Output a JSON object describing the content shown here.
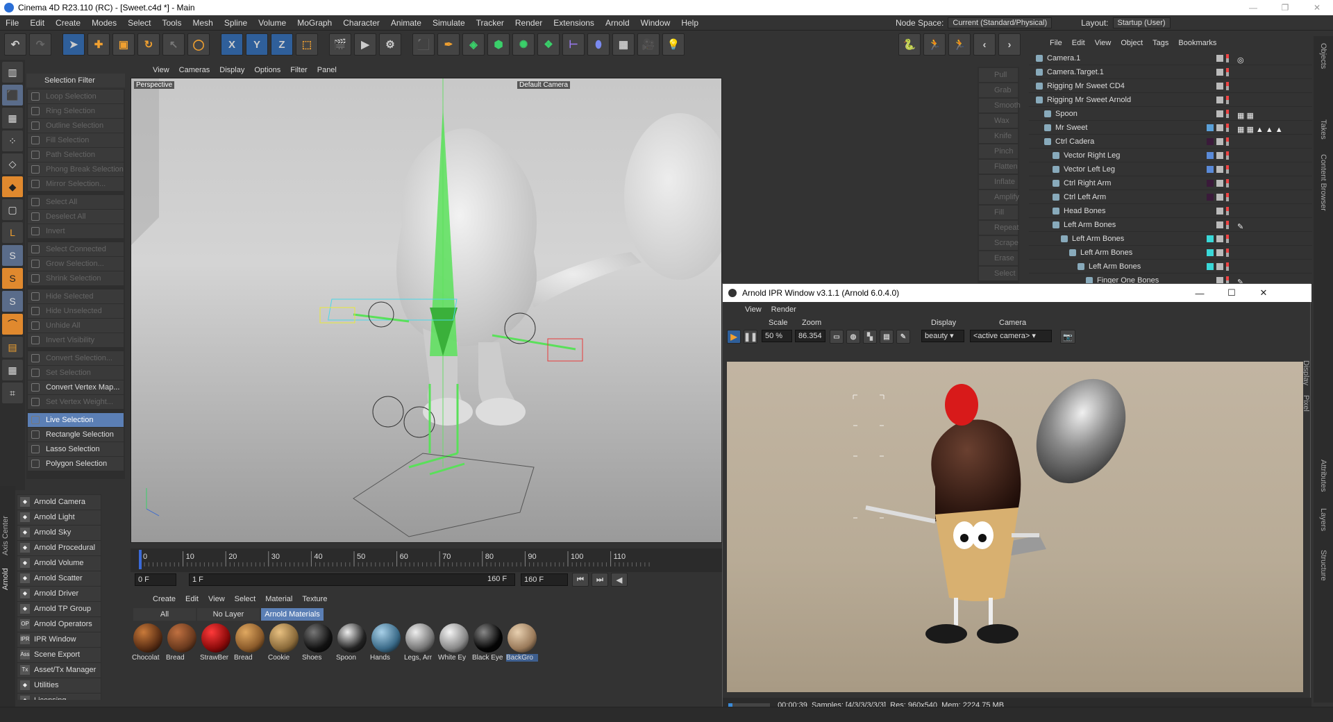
{
  "window": {
    "title": "Cinema 4D R23.110 (RC) - [Sweet.c4d *] - Main",
    "controls": [
      "—",
      "❐",
      "✕"
    ]
  },
  "menubar": {
    "items": [
      "File",
      "Edit",
      "Create",
      "Modes",
      "Select",
      "Tools",
      "Mesh",
      "Spline",
      "Volume",
      "MoGraph",
      "Character",
      "Animate",
      "Simulate",
      "Tracker",
      "Render",
      "Extensions",
      "Arnold",
      "Window",
      "Help"
    ],
    "node_space_label": "Node Space:",
    "node_space_value": "Current (Standard/Physical)",
    "layout_label": "Layout:",
    "layout_value": "Startup (User)"
  },
  "toolbar": {
    "axis_x": "X",
    "axis_y": "Y",
    "axis_z": "Z"
  },
  "selection_menu": {
    "header": "Selection Filter",
    "items": [
      {
        "label": "Loop Selection",
        "enabled": false
      },
      {
        "label": "Ring Selection",
        "enabled": false
      },
      {
        "label": "Outline Selection",
        "enabled": false
      },
      {
        "label": "Fill Selection",
        "enabled": false
      },
      {
        "label": "Path Selection",
        "enabled": false
      },
      {
        "label": "Phong Break Selection",
        "enabled": false
      },
      {
        "label": "Mirror Selection...",
        "enabled": false
      },
      {
        "label": "Select All",
        "enabled": false,
        "gap": true
      },
      {
        "label": "Deselect All",
        "enabled": false
      },
      {
        "label": "Invert",
        "enabled": false
      },
      {
        "label": "Select Connected",
        "enabled": false,
        "gap": true
      },
      {
        "label": "Grow Selection...",
        "enabled": false
      },
      {
        "label": "Shrink Selection",
        "enabled": false
      },
      {
        "label": "Hide Selected",
        "enabled": false,
        "gap": true
      },
      {
        "label": "Hide Unselected",
        "enabled": false
      },
      {
        "label": "Unhide All",
        "enabled": false
      },
      {
        "label": "Invert Visibility",
        "enabled": false
      },
      {
        "label": "Convert Selection...",
        "enabled": false,
        "gap": true
      },
      {
        "label": "Set Selection",
        "enabled": false
      },
      {
        "label": "Convert Vertex Map...",
        "enabled": true
      },
      {
        "label": "Set Vertex Weight...",
        "enabled": false
      },
      {
        "label": "Live Selection",
        "enabled": true,
        "active": true,
        "gap": true
      },
      {
        "label": "Rectangle Selection",
        "enabled": true
      },
      {
        "label": "Lasso Selection",
        "enabled": true
      },
      {
        "label": "Polygon Selection",
        "enabled": true
      }
    ]
  },
  "arnold_panel": {
    "side_tabs": [
      "Axis Center",
      "Arnold"
    ],
    "items": [
      {
        "label": "Arnold Camera",
        "icon": "camera-icon"
      },
      {
        "label": "Arnold Light",
        "icon": "light-icon"
      },
      {
        "label": "Arnold Sky",
        "icon": "sky-icon"
      },
      {
        "label": "Arnold Procedural",
        "icon": "procedural-icon"
      },
      {
        "label": "Arnold Volume",
        "icon": "volume-icon"
      },
      {
        "label": "Arnold Scatter",
        "icon": "scatter-icon"
      },
      {
        "label": "Arnold Driver",
        "icon": "driver-icon"
      },
      {
        "label": "Arnold TP Group",
        "icon": "tp-group-icon"
      },
      {
        "label": "Arnold Operators",
        "icon": "operators-icon",
        "glyph": "OP"
      },
      {
        "label": "IPR Window",
        "icon": "ipr-icon",
        "glyph": "IPR"
      },
      {
        "label": "Scene Export",
        "icon": "export-icon",
        "glyph": "Ass"
      },
      {
        "label": "Asset/Tx Manager",
        "icon": "tx-icon",
        "glyph": "Tx"
      },
      {
        "label": "Utilities",
        "icon": "utilities-icon"
      },
      {
        "label": "Licensing",
        "icon": "licensing-icon"
      }
    ]
  },
  "viewport": {
    "menu": [
      "View",
      "Cameras",
      "Display",
      "Options",
      "Filter",
      "Panel"
    ],
    "label": "Perspective",
    "camera_label": "Default Camera"
  },
  "sculpt": {
    "items": [
      "Pull",
      "Grab",
      "Smooth",
      "Wax",
      "Knife",
      "Pinch",
      "Flatten",
      "Inflate",
      "Amplify",
      "Fill",
      "Repeat",
      "Scrape",
      "Erase",
      "Select"
    ]
  },
  "timeline": {
    "ticks": [
      "0",
      "10",
      "20",
      "30",
      "40",
      "50",
      "60",
      "70",
      "80",
      "90",
      "100",
      "110"
    ],
    "current_frame": "0 F",
    "start_frame": "1 F",
    "end_frame_a": "160 F",
    "end_frame_b": "160 F"
  },
  "material_manager": {
    "menu": [
      "Create",
      "Edit",
      "View",
      "Select",
      "Material",
      "Texture"
    ],
    "tabs": [
      {
        "label": "All",
        "active": false
      },
      {
        "label": "No Layer",
        "active": false
      },
      {
        "label": "Arnold Materials",
        "active": true
      }
    ],
    "materials": [
      {
        "name": "Chocolat",
        "color": "#5a2e14",
        "hi": "#c97a3a",
        "selected": false
      },
      {
        "name": "Bread",
        "color": "#6a3a1e",
        "hi": "#c07040",
        "selected": false
      },
      {
        "name": "StrawBer",
        "color": "#8a0a0a",
        "hi": "#ff3a3a",
        "selected": false
      },
      {
        "name": "Bread",
        "color": "#8a5a2a",
        "hi": "#e0a860",
        "selected": false
      },
      {
        "name": "Cookie",
        "color": "#8a6a3a",
        "hi": "#e8c080",
        "selected": false
      },
      {
        "name": "Shoes",
        "color": "#111111",
        "hi": "#777777",
        "selected": false
      },
      {
        "name": "Spoon",
        "color": "#222222",
        "hi": "#eeeeee",
        "selected": false
      },
      {
        "name": "Hands",
        "color": "#3a6a88",
        "hi": "#a8d0e8",
        "selected": false
      },
      {
        "name": "Legs, Arr",
        "color": "#777777",
        "hi": "#eeeeee",
        "selected": false
      },
      {
        "name": "White Ey",
        "color": "#888888",
        "hi": "#f4f4f4",
        "selected": false
      },
      {
        "name": "Black Eye",
        "color": "#050505",
        "hi": "#888888",
        "selected": false
      },
      {
        "name": "BackGro",
        "color": "#9a7a5a",
        "hi": "#e8d0b0",
        "selected": true
      }
    ]
  },
  "object_manager": {
    "menu": [
      "File",
      "Edit",
      "View",
      "Object",
      "Tags",
      "Bookmarks"
    ],
    "side_tabs": [
      "Objects",
      "Takes",
      "Content Browser",
      "Attributes",
      "Layers",
      "Structure"
    ],
    "objects": [
      {
        "label": "Camera.1",
        "depth": 0,
        "layer": "#333",
        "tags": "◎"
      },
      {
        "label": "Camera.Target.1",
        "depth": 0,
        "layer": "#333",
        "tags": ""
      },
      {
        "label": "Rigging Mr Sweet CD4",
        "depth": 0,
        "layer": "#333",
        "tags": ""
      },
      {
        "label": "Rigging Mr Sweet Arnold",
        "depth": 0,
        "layer": "#333",
        "tags": ""
      },
      {
        "label": "Spoon",
        "depth": 1,
        "layer": "#333",
        "tags": "▦ ▦"
      },
      {
        "label": "Mr Sweet",
        "depth": 1,
        "layer": "#5aa0d8",
        "tags": "▦ ▦ ▲ ▲ ▲"
      },
      {
        "label": "Ctrl Cadera",
        "depth": 1,
        "layer": "#3a1a3a",
        "tags": ""
      },
      {
        "label": "Vector Right Leg",
        "depth": 2,
        "layer": "#5a8ad8",
        "tags": ""
      },
      {
        "label": "Vector Left Leg",
        "depth": 2,
        "layer": "#5a8ad8",
        "tags": ""
      },
      {
        "label": "Ctrl Right Arm",
        "depth": 2,
        "layer": "#3a1a3a",
        "tags": ""
      },
      {
        "label": "Ctrl Left Arm",
        "depth": 2,
        "layer": "#3a1a3a",
        "tags": ""
      },
      {
        "label": "Head Bones",
        "depth": 2,
        "layer": "#333",
        "tags": ""
      },
      {
        "label": "Left Arm Bones",
        "depth": 2,
        "layer": "#333",
        "tags": "✎"
      },
      {
        "label": "Left Arm Bones",
        "depth": 3,
        "layer": "#3ad8d8",
        "tags": ""
      },
      {
        "label": "Left Arm Bones",
        "depth": 4,
        "layer": "#3ad8d8",
        "tags": ""
      },
      {
        "label": "Left Arm Bones",
        "depth": 5,
        "layer": "#3ad8d8",
        "tags": ""
      },
      {
        "label": "Finger One Bones",
        "depth": 6,
        "layer": "#333",
        "tags": "✎"
      }
    ]
  },
  "ipr": {
    "title": "Arnold IPR Window v3.1.1 (Arnold 6.0.4.0)",
    "menu": [
      "View",
      "Render"
    ],
    "scale_label": "Scale",
    "scale_value": "50 %",
    "zoom_label": "Zoom",
    "zoom_value": "86.354",
    "display_label": "Display",
    "display_value": "beauty",
    "camera_label": "Camera",
    "camera_value": "<active camera>",
    "side_tabs": [
      "Display",
      "Pixel"
    ],
    "status": {
      "time": "00:00:39",
      "samples": "Samples: [4/3/3/3/3/3]",
      "res": "Res: 960x540",
      "mem": "Mem: 2224.75 MB"
    }
  }
}
